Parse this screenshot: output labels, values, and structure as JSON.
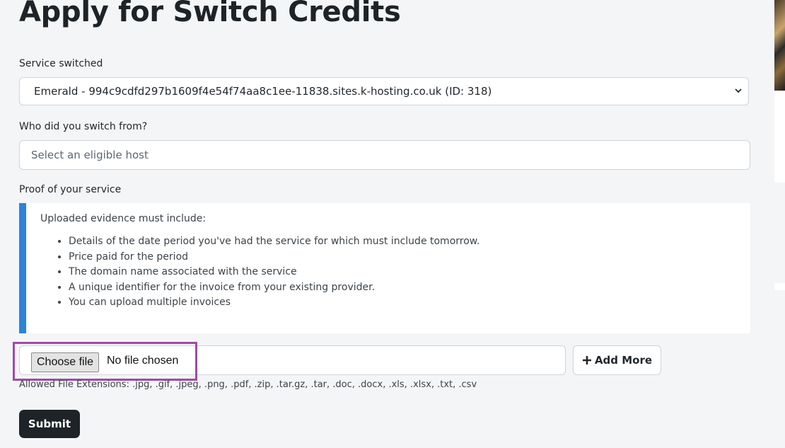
{
  "page": {
    "title": "Apply for Switch Credits"
  },
  "form": {
    "service_label": "Service switched",
    "service_selected": "Emerald - 994c9cdfd297b1609f4e54f74aa8c1ee-11838.sites.k-hosting.co.uk (ID: 318)",
    "host_label": "Who did you switch from?",
    "host_placeholder": "Select an eligible host",
    "proof_label": "Proof of your service",
    "notice": {
      "intro": "Uploaded evidence must include:",
      "items": [
        "Details of the date period you've had the service for which must include tomorrow.",
        "Price paid for the period",
        "The domain name associated with the service",
        "A unique identifier for the invoice from your existing provider.",
        "You can upload multiple invoices"
      ]
    },
    "file": {
      "button_label": "Choose file",
      "status": "No file chosen"
    },
    "add_more_label": "Add More",
    "allowed_extensions": "Allowed File Extensions: .jpg, .gif, .jpeg, .png, .pdf, .zip, .tar.gz, .tar, .doc, .docx, .xls, .xlsx, .txt, .csv",
    "submit_label": "Submit"
  },
  "icons": {
    "select_chevron": "chevron-down-icon",
    "add_more": "plus-icon"
  },
  "colors": {
    "notice_accent": "#2b83da",
    "highlight": "#a24aa6",
    "submit_bg": "#1d2327"
  }
}
